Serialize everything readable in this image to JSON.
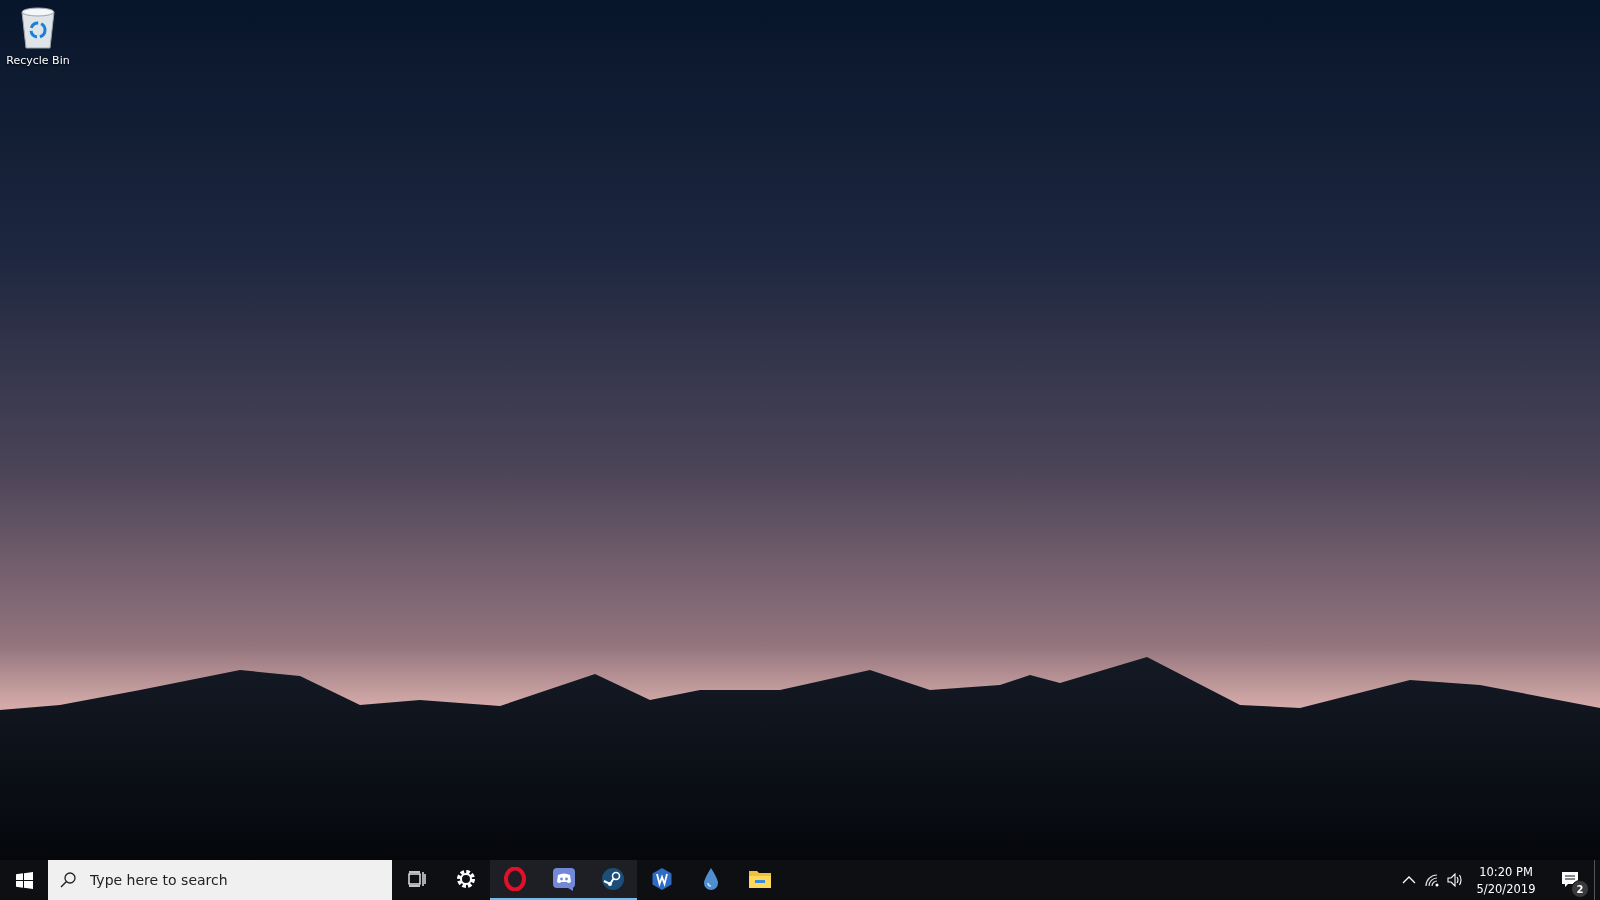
{
  "desktop_icons": [
    {
      "label": "Recycle Bin"
    }
  ],
  "taskbar": {
    "search": {
      "placeholder": "Type here to search"
    },
    "apps": [
      {
        "kind": "settings",
        "running": false
      },
      {
        "kind": "opera",
        "running": true
      },
      {
        "kind": "discord",
        "running": true
      },
      {
        "kind": "steam",
        "running": true
      },
      {
        "kind": "w",
        "running": false
      },
      {
        "kind": "drop",
        "running": false
      },
      {
        "kind": "explorer",
        "running": false
      }
    ],
    "clock": {
      "time": "10:20 PM",
      "date": "5/20/2019"
    },
    "notifications": {
      "count": "2"
    }
  }
}
